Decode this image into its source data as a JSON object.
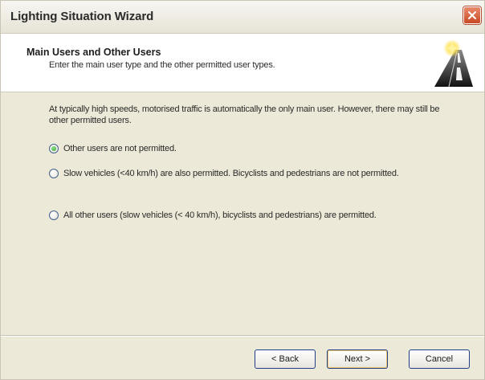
{
  "window": {
    "title": "Lighting Situation Wizard"
  },
  "header": {
    "title": "Main Users and Other Users",
    "subtitle": "Enter the main user type and the other permitted user types.",
    "icon": "road-with-light-icon"
  },
  "content": {
    "intro": "At typically high speeds, motorised traffic is automatically the only main user. However, there may still be other permitted users.",
    "options": [
      {
        "label": "Other users are not permitted.",
        "selected": true
      },
      {
        "label": "Slow vehicles (<40 km/h) are also permitted. Bicyclists and pedestrians are not permitted.",
        "selected": false
      },
      {
        "label": "All other users (slow vehicles (< 40 km/h), bicyclists and pedestrians) are permitted.",
        "selected": false
      }
    ]
  },
  "buttons": {
    "back": "< Back",
    "next": "Next >",
    "cancel": "Cancel"
  },
  "colors": {
    "window_bg": "#ece9d8",
    "button_border": "#1f3f8a",
    "close_button": "#c84a24",
    "radio_selected": "#2fa332"
  }
}
